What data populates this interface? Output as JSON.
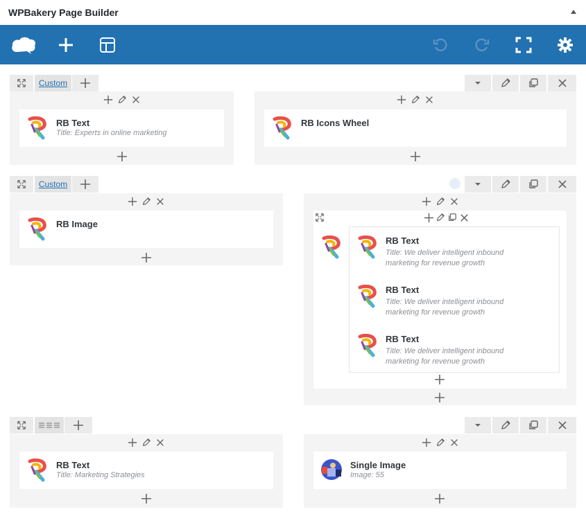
{
  "panel": {
    "title": "WPBakery Page Builder"
  },
  "toolbar": {
    "icons": [
      "logo-cloud-icon",
      "add-element-icon",
      "templates-icon",
      "undo-icon",
      "redo-icon",
      "fullscreen-icon",
      "settings-icon"
    ],
    "bg_color": "#2271b1"
  },
  "rows": [
    {
      "layout_label": "Custom",
      "columns": [
        {
          "elements": [
            {
              "title": "RB Text",
              "subtitle": "Title: Experts in online marketing"
            }
          ]
        },
        {
          "elements": [
            {
              "title": "RB Icons Wheel",
              "subtitle": ""
            }
          ]
        }
      ]
    },
    {
      "layout_label": "Custom",
      "columns": [
        {
          "elements": [
            {
              "title": "RB Image",
              "subtitle": ""
            }
          ]
        },
        {
          "inner": {
            "elements": [
              {
                "title": "RB Text",
                "subtitle1": "Title: We deliver intelligent inbound",
                "subtitle2": "marketing for revenue growth"
              },
              {
                "title": "RB Text",
                "subtitle1": "Title: We deliver intelligent inbound",
                "subtitle2": "marketing for revenue growth"
              },
              {
                "title": "RB Text",
                "subtitle1": "Title: We deliver intelligent inbound",
                "subtitle2": "marketing for revenue growth"
              }
            ]
          }
        }
      ]
    },
    {
      "layout_label": "",
      "columns": [
        {
          "elements": [
            {
              "title": "RB Text",
              "subtitle": "Title: Marketing Strategies"
            }
          ]
        },
        {
          "elements": [
            {
              "title": "Single Image",
              "subtitle": "Image: 55"
            }
          ]
        }
      ]
    }
  ]
}
